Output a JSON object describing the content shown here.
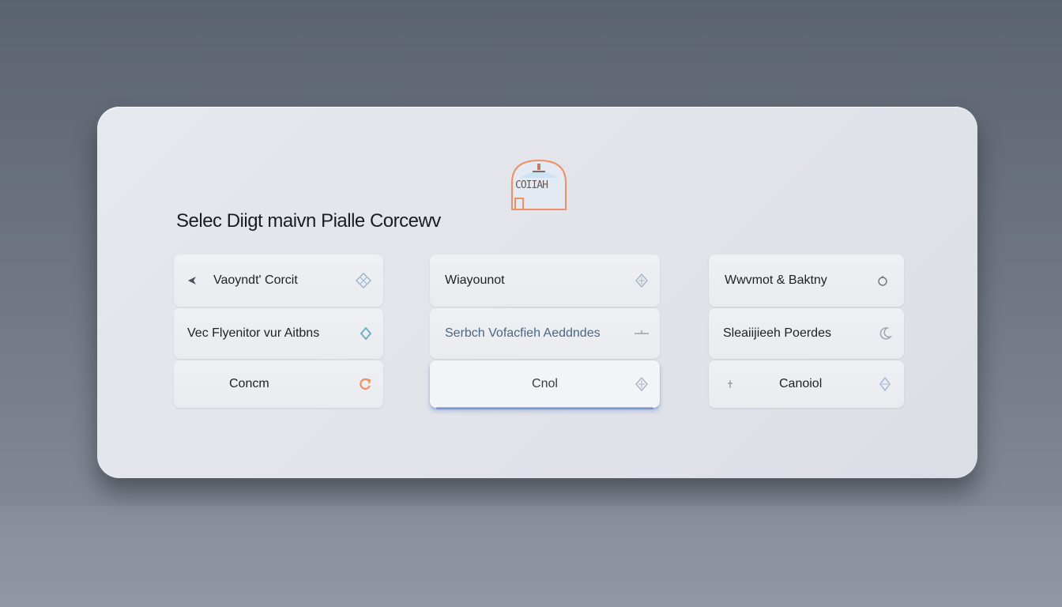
{
  "dialog": {
    "logo_text": "COIIAH",
    "title": "Selec Diigt maivn Pialle Corcewv"
  },
  "columns": [
    {
      "items": [
        {
          "label": "Vaoyndt' Corcit",
          "icon": "chevron-left-icon",
          "icon2": "diamond-outline-icon"
        },
        {
          "label": "Vec Flyenitor vur  Aitbns",
          "icon": "diamond-icon"
        },
        {
          "label": "Concm",
          "icon": "refresh-icon"
        }
      ]
    },
    {
      "items": [
        {
          "label": "Wiayounot",
          "icon": "gem-icon"
        },
        {
          "label": "Serbch  Vofacfieh Aeddndes",
          "icon": "minus-icon"
        },
        {
          "label": "Cnol",
          "icon": "gem-icon"
        }
      ]
    },
    {
      "items": [
        {
          "label": "Wwvmot  & Baktny",
          "icon": "circle-icon"
        },
        {
          "label": "Sleaiijieeh  Poerdes",
          "icon": "moon-icon"
        },
        {
          "label": "Canoiol",
          "icon": "gem-icon",
          "lead_icon": "pin-icon"
        }
      ]
    }
  ],
  "colors": {
    "accent_orange": "#ef8f62",
    "accent_teal": "#6fb1c4",
    "accent_blue": "#5a82d2"
  }
}
